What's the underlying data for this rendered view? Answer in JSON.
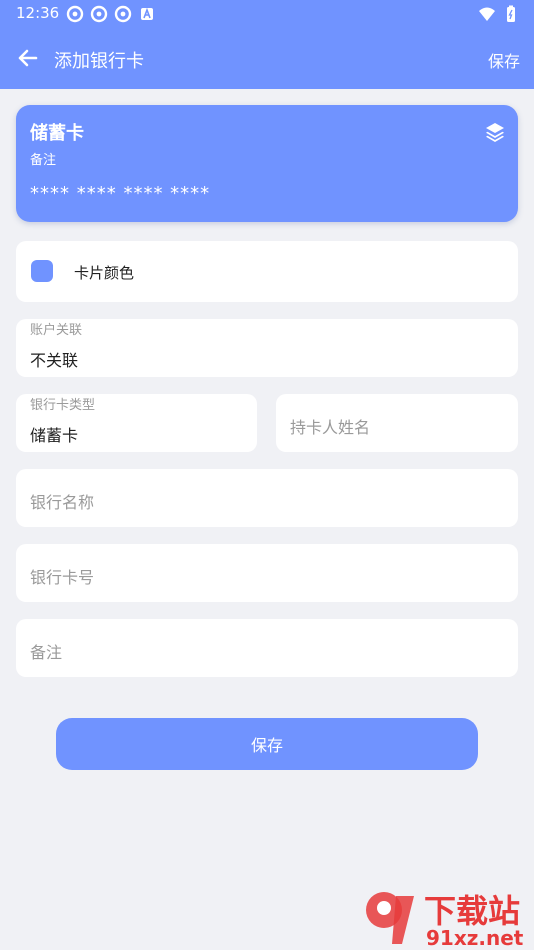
{
  "status_bar": {
    "time": "12:36",
    "icons": [
      "sync-icon",
      "sync-icon",
      "sync-icon",
      "a-badge-icon"
    ],
    "right_icons": [
      "wifi-icon",
      "battery-icon"
    ]
  },
  "app_bar": {
    "title": "添加银行卡",
    "save_label": "保存"
  },
  "card_preview": {
    "type": "储蓄卡",
    "note": "备注",
    "number": "**** **** **** ****",
    "color": "#7093ff"
  },
  "form": {
    "card_color_label": "卡片颜色",
    "account_link": {
      "label": "账户关联",
      "value": "不关联"
    },
    "card_type": {
      "label": "银行卡类型",
      "value": "储蓄卡"
    },
    "holder_name": {
      "placeholder": "持卡人姓名"
    },
    "bank_name": {
      "placeholder": "银行名称"
    },
    "card_number": {
      "placeholder": "银行卡号"
    },
    "note": {
      "placeholder": "备注"
    }
  },
  "save_button": {
    "label": "保存"
  },
  "watermark": {
    "text_top": "下载站",
    "text_bottom": "91xz.net"
  },
  "colors": {
    "primary": "#7093ff",
    "background": "#f0f1f5",
    "watermark": "#e63b3b"
  }
}
